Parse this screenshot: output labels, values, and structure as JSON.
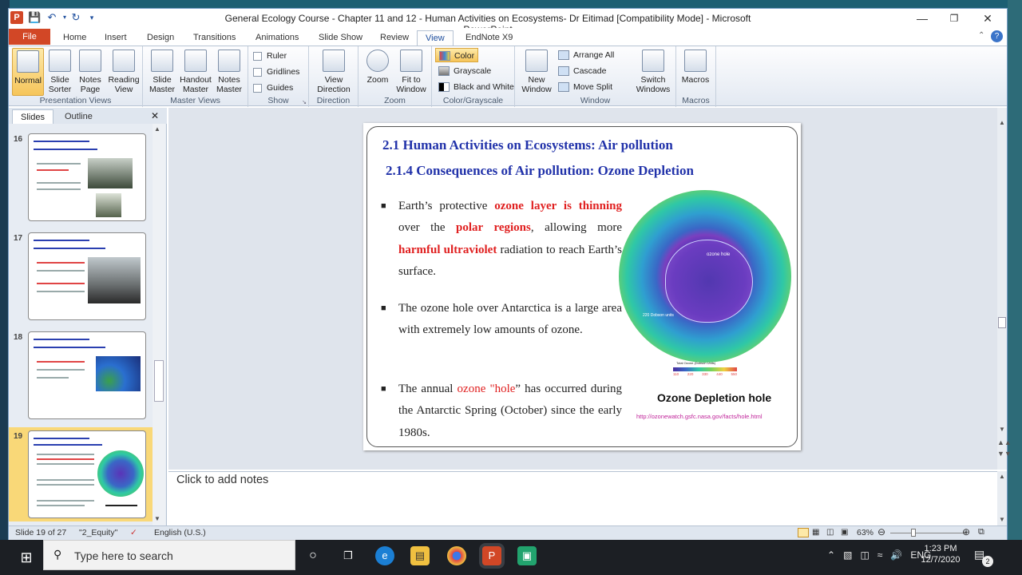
{
  "window": {
    "title": "General Ecology Course - Chapter  11 and 12 - Human Activities on  Ecosystems- Dr Eitimad [Compatibility Mode]  -  Microsoft PowerPoint",
    "app_letter": "P"
  },
  "tabs": [
    "File",
    "Home",
    "Insert",
    "Design",
    "Transitions",
    "Animations",
    "Slide Show",
    "Review",
    "View",
    "EndNote X9"
  ],
  "active_tab": "View",
  "ribbon": {
    "presentation_views": {
      "label": "Presentation Views",
      "buttons": [
        "Normal",
        "Slide Sorter",
        "Notes Page",
        "Reading View"
      ]
    },
    "master_views": {
      "label": "Master Views",
      "buttons": [
        "Slide Master",
        "Handout Master",
        "Notes Master"
      ]
    },
    "show": {
      "label": "Show",
      "items": [
        "Ruler",
        "Gridlines",
        "Guides"
      ]
    },
    "direction": {
      "label": "Direction",
      "button": "View Direction"
    },
    "zoom": {
      "label": "Zoom",
      "buttons": [
        "Zoom",
        "Fit to Window"
      ]
    },
    "color": {
      "label": "Color/Grayscale",
      "items": [
        "Color",
        "Grayscale",
        "Black and White"
      ]
    },
    "window": {
      "label": "Window",
      "new": "New Window",
      "items": [
        "Arrange All",
        "Cascade",
        "Move Split"
      ],
      "switch": "Switch Windows"
    },
    "macros": {
      "label": "Macros",
      "button": "Macros"
    }
  },
  "left_pane": {
    "tabs": [
      "Slides",
      "Outline"
    ],
    "thumbnails": [
      {
        "num": "16",
        "selected": false
      },
      {
        "num": "17",
        "selected": false
      },
      {
        "num": "18",
        "selected": false
      },
      {
        "num": "19",
        "selected": true
      }
    ]
  },
  "slide": {
    "title": "2.1 Human Activities on Ecosystems: Air pollution",
    "subtitle": "2.1.4 Consequences of Air pollution: Ozone Depletion",
    "bullet1": {
      "a": "Earth’s protective ",
      "b": "ozone layer is thinning",
      "c": " over the ",
      "d": "polar regions",
      "e": ", allowing more ",
      "f": "harmful ultraviolet",
      "g": " radiation to reach Earth’s surface."
    },
    "bullet2": "The ozone hole over Antarctica is a large area with extremely low amounts of ozone.",
    "bullet3": {
      "a": "The annual ",
      "b": "ozone \"hole",
      "c": "” has occurred during the Antarctic Spring (October) since the early 1980s."
    },
    "image": {
      "hole_label": "ozone hole",
      "dobson_label": "220 Dobson units",
      "scale_title": "Total Ozone (Dobson Units)",
      "scale_ticks": [
        "110",
        "220",
        "330",
        "440",
        "550"
      ]
    },
    "caption": "Ozone Depletion hole",
    "url": "http://ozonewatch.gsfc.nasa.gov/facts/hole.html"
  },
  "notes_placeholder": "Click to add notes",
  "status": {
    "slide": "Slide 19 of 27",
    "theme": "\"2_Equity\"",
    "language": "English (U.S.)",
    "zoom": "63%"
  },
  "taskbar": {
    "search_placeholder": "Type here to search",
    "lang": "ENG",
    "time": "1:23 PM",
    "date": "12/7/2020",
    "notif": "2"
  }
}
